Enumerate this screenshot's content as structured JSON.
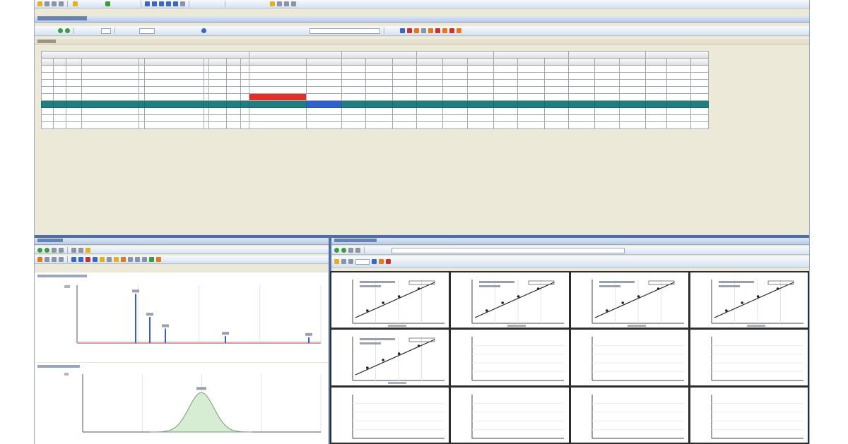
{
  "colors": {
    "selected_row": "#1f7f7f",
    "selected_cell": "#2f5fd0",
    "flag_cell": "#e3312a",
    "panel_header": "#b9cbe6",
    "splitter": "#4d6ea8",
    "peak_fill": "#d6ecd3"
  },
  "icons": {
    "main_toolbar": [
      "folder-icon",
      "save-icon",
      "print-icon",
      "undo-icon",
      "settings-icon",
      "table-icon",
      "grid-icon",
      "filter-icon",
      "sort-icon",
      "export-icon",
      "refresh-icon"
    ],
    "sub_toolbar": [
      "play-icon",
      "stop-icon",
      "calendar-icon",
      "search-icon",
      "flag-icon",
      "check-icon",
      "warning-icon",
      "info-icon",
      "delete-icon",
      "help-icon"
    ],
    "chrom_toolbar": [
      "zoom-in-icon",
      "zoom-out-icon",
      "pan-icon",
      "peak-icon",
      "baseline-icon",
      "integrate-icon",
      "label-icon",
      "print-icon",
      "copy-icon",
      "export-icon"
    ],
    "cal_toolbar": [
      "refresh-icon",
      "fit-icon",
      "weight-icon",
      "print-icon",
      "copy-icon"
    ]
  },
  "grid": {
    "row_count": 9,
    "col_count": 27,
    "selected_row": 5,
    "flag_cell": [
      4,
      10
    ],
    "selected_cell": [
      5,
      11
    ]
  },
  "chromatogram": {
    "peaks_top": [
      0.0,
      0.85,
      0.45,
      0.25,
      0.12,
      0.1
    ],
    "peak_bottom_level": 0.68
  },
  "calibration": {
    "filled_cells": 5,
    "empty_cells": 7
  }
}
